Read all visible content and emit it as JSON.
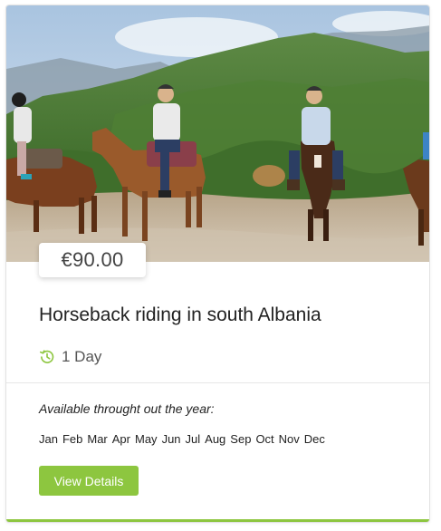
{
  "tour": {
    "price": "€90.00",
    "title": "Horseback riding in south Albania",
    "duration": "1 Day",
    "availability_note": "Available throught out the year:",
    "months": [
      "Jan",
      "Feb",
      "Mar",
      "Apr",
      "May",
      "Jun",
      "Jul",
      "Aug",
      "Sep",
      "Oct",
      "Nov",
      "Dec"
    ],
    "details_button": "View Details"
  },
  "colors": {
    "accent": "#8dc63f",
    "title_text": "#222222",
    "price_text": "#444444"
  },
  "icons": {
    "duration": "clock-history-icon"
  }
}
